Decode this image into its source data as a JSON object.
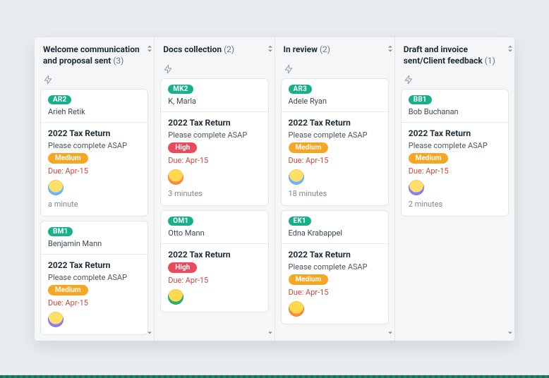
{
  "columns": [
    {
      "title": "Welcome communication and proposal sent",
      "count": "(3)",
      "cards": [
        {
          "id": "AR2",
          "client": "Arieh Retik",
          "task": "2022 Tax Return",
          "desc": "Please complete ASAP",
          "priority_label": "Medium",
          "priority_class": "medium",
          "due": "Due: Apr-15",
          "avatar_class": "av1",
          "time": "a minute"
        },
        {
          "id": "BM1",
          "client": "Benjamin Mann",
          "task": "2022 Tax Return",
          "desc": "Please complete ASAP",
          "priority_label": "Medium",
          "priority_class": "medium",
          "due": "Due: Apr-15",
          "avatar_class": "av3",
          "time": ""
        }
      ]
    },
    {
      "title": "Docs collection",
      "count": "(2)",
      "cards": [
        {
          "id": "MK2",
          "client": "K, Marla",
          "task": "2022 Tax Return",
          "desc": "Please complete ASAP",
          "priority_label": "High",
          "priority_class": "high",
          "due": "Due: Apr-15",
          "avatar_class": "av2",
          "time": "3 minutes"
        },
        {
          "id": "OM1",
          "client": "Otto Mann",
          "task": "2022 Tax Return",
          "desc": "",
          "priority_label": "High",
          "priority_class": "high",
          "due": "Due: Apr-15",
          "avatar_class": "av4",
          "time": ""
        }
      ]
    },
    {
      "title": "In review",
      "count": "(2)",
      "cards": [
        {
          "id": "AR3",
          "client": "Adele Ryan",
          "task": "2022 Tax Return",
          "desc": "Please complete ASAP",
          "priority_label": "Medium",
          "priority_class": "medium",
          "due": "Due: Apr-15",
          "avatar_class": "av1",
          "time": "18 minutes"
        },
        {
          "id": "EK1",
          "client": "Edna Krabappel",
          "task": "2022 Tax Return",
          "desc": "Please complete ASAP",
          "priority_label": "Medium",
          "priority_class": "medium",
          "due": "Due: Apr-15",
          "avatar_class": "av2",
          "time": ""
        }
      ]
    },
    {
      "title": "Draft and invoice sent/Client feedback",
      "count": "(1)",
      "cards": [
        {
          "id": "BB1",
          "client": "Bob Buchanan",
          "task": "2022 Tax Return",
          "desc": "Please complete ASAP",
          "priority_label": "Medium",
          "priority_class": "medium",
          "due": "Due: Apr-15",
          "avatar_class": "av3",
          "time": "2 minutes"
        }
      ]
    }
  ]
}
